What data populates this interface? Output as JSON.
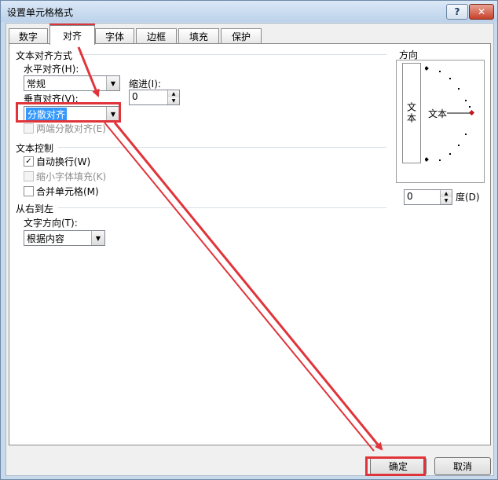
{
  "window": {
    "title": "设置单元格格式",
    "help": "?",
    "close": "✕"
  },
  "tabs": [
    {
      "label": "数字",
      "active": false
    },
    {
      "label": "对齐",
      "active": true
    },
    {
      "label": "字体",
      "active": false
    },
    {
      "label": "边框",
      "active": false
    },
    {
      "label": "填充",
      "active": false
    },
    {
      "label": "保护",
      "active": false
    }
  ],
  "alignment": {
    "section": "文本对齐方式",
    "horizontal_label": "水平对齐(H):",
    "horizontal_value": "常规",
    "indent_label": "缩进(I):",
    "indent_value": "0",
    "vertical_label": "垂直对齐(V):",
    "vertical_value": "分散对齐",
    "justify_distributed": "两端分散对齐(E)"
  },
  "text_control": {
    "section": "文本控制",
    "wrap": "自动换行(W)",
    "wrap_checked": true,
    "shrink": "缩小字体填充(K)",
    "merge": "合并单元格(M)"
  },
  "rtl": {
    "section": "从右到左",
    "direction_label": "文字方向(T):",
    "direction_value": "根据内容"
  },
  "orientation": {
    "section": "方向",
    "vertical_text": "文本",
    "text": "文本",
    "degree_value": "0",
    "degree_label": "度(D)"
  },
  "buttons": {
    "ok": "确定",
    "cancel": "取消"
  },
  "colors": {
    "annotation": "#e0343a",
    "selection": "#3399ff"
  }
}
